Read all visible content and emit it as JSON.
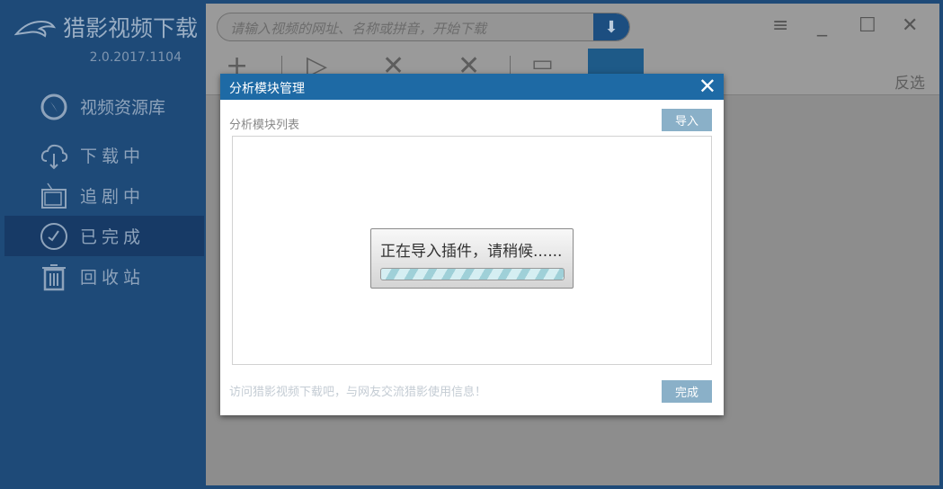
{
  "app": {
    "title": "猎影视频下载",
    "version": "2.0.2017.1104"
  },
  "sidebar": {
    "items": [
      {
        "label": "视频资源库",
        "icon": "compass-icon"
      },
      {
        "label": "下载中",
        "icon": "cloud-download-icon"
      },
      {
        "label": "追剧中",
        "icon": "tv-icon"
      },
      {
        "label": "已完成",
        "icon": "check-circle-icon",
        "active": true
      },
      {
        "label": "回收站",
        "icon": "trash-icon"
      }
    ]
  },
  "search": {
    "placeholder": "请输入视频的网址、名称或拼音，开始下载"
  },
  "toolbar": {
    "invert_selection": "反选"
  },
  "dialog": {
    "title": "分析模块管理",
    "list_label": "分析模块列表",
    "import_label": "导入",
    "done_label": "完成",
    "footer_text": "访问猎影视频下载吧，与网友交流猎影使用信息！",
    "busy_text": "正在导入插件，请稍候......",
    "close": "✕"
  }
}
